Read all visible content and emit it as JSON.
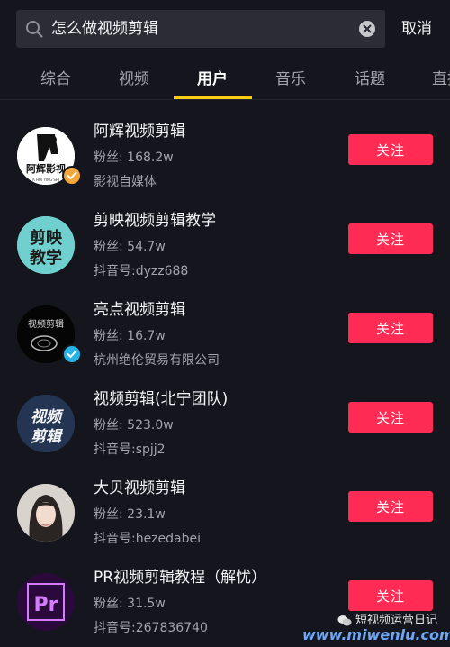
{
  "search": {
    "query": "怎么做视频剪辑",
    "cancel_label": "取消"
  },
  "tabs": [
    {
      "label": "综合"
    },
    {
      "label": "视频"
    },
    {
      "label": "用户"
    },
    {
      "label": "音乐"
    },
    {
      "label": "话题"
    },
    {
      "label": "直播"
    }
  ],
  "active_tab": "用户",
  "users": [
    {
      "name": "阿辉视频剪辑",
      "fans": "粉丝: 168.2w",
      "desc": "影视自媒体",
      "follow_label": "关注",
      "avatar_text": "阿辉影视",
      "avatar_subtext": "A HUI YING SHI",
      "badge": "orange"
    },
    {
      "name": "剪映视频剪辑教学",
      "fans": "粉丝: 54.7w",
      "desc": "抖音号:dyzz688",
      "follow_label": "关注",
      "avatar_text_line1": "剪映",
      "avatar_text_line2": "教学"
    },
    {
      "name": "亮点视频剪辑",
      "fans": "粉丝: 16.7w",
      "desc": "杭州绝伦贸易有限公司",
      "follow_label": "关注",
      "avatar_text": "视频剪辑",
      "badge": "blue"
    },
    {
      "name": "视频剪辑(北宁团队)",
      "fans": "粉丝: 523.0w",
      "desc": "抖音号:spjj2",
      "follow_label": "关注",
      "avatar_text_line1": "视频",
      "avatar_text_line2": "剪辑"
    },
    {
      "name": "大贝视频剪辑",
      "fans": "粉丝: 23.1w",
      "desc": "抖音号:hezedabei",
      "follow_label": "关注"
    },
    {
      "name": "PR视频剪辑教程（解忧）",
      "fans": "粉丝: 31.5w",
      "desc": "抖音号:267836740",
      "follow_label": "关注",
      "avatar_text": "Pr"
    }
  ],
  "watermark": {
    "account": "短视频运营日记",
    "url": "www.miwenlu.com"
  },
  "colors": {
    "background": "#15161d",
    "accent_underline": "#face15",
    "follow_button": "#fe2c55",
    "badge_orange": "#f3a73b",
    "badge_blue": "#25b4e5"
  }
}
